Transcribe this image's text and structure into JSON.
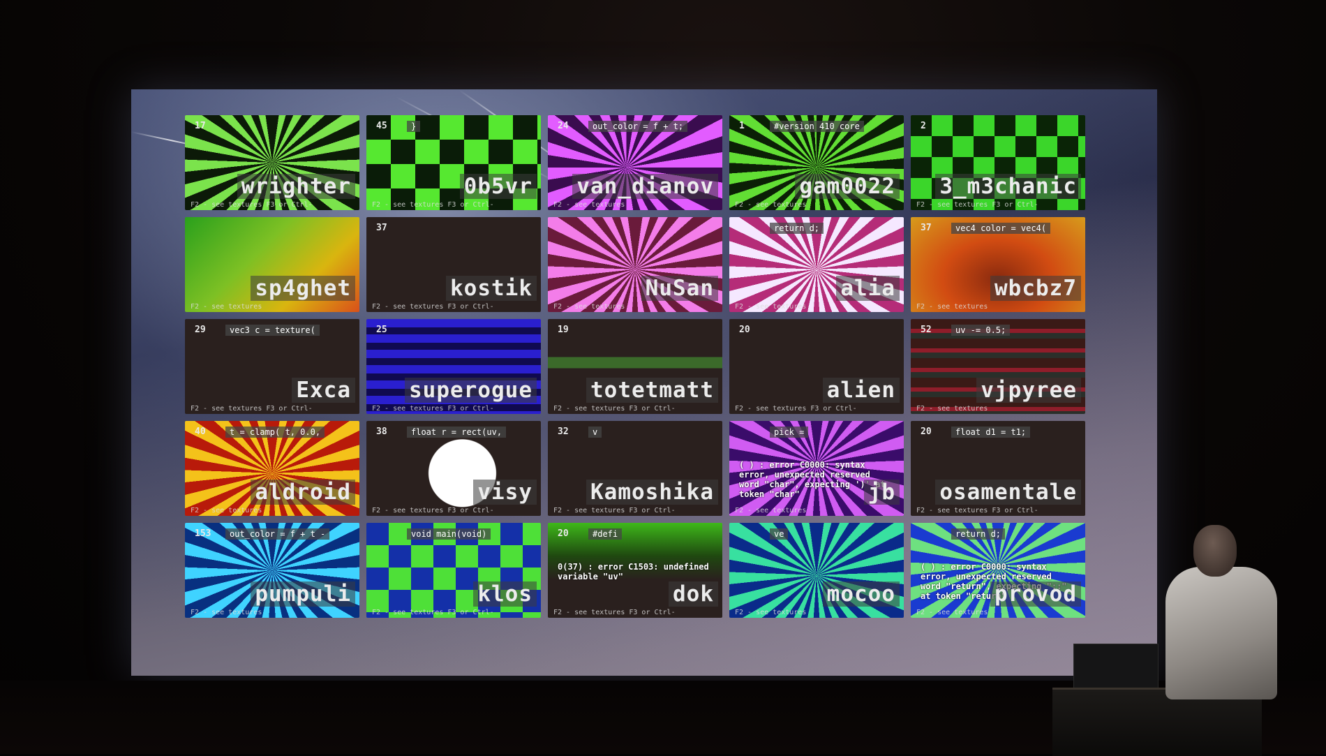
{
  "tiles": [
    {
      "num": "17",
      "code": "",
      "name": "wrighter",
      "footer": "F2 - see textures   F3 or Ctrl-",
      "bg": "tunnel-green"
    },
    {
      "num": "45",
      "code": "}",
      "name": "0b5vr",
      "footer": "F2 - see textures   F3 or Ctrl-",
      "bg": "check-green"
    },
    {
      "num": "24",
      "code": "out_color = f + t;",
      "name": "van_dianov",
      "footer": "F2 - see textures",
      "bg": "tunnel-purple"
    },
    {
      "num": "1",
      "code": "#version 410 core",
      "name": "gam0022",
      "footer": "F2 - see textures",
      "bg": "tunnel-green2"
    },
    {
      "num": "2",
      "code": "",
      "name": "3_m3chanic",
      "footer": "F2 - see textures   F3 or Ctrl-",
      "bg": "check-green2"
    },
    {
      "num": "",
      "code": "",
      "name": "sp4ghet",
      "footer": "F2 - see textures",
      "bg": "grad-lime"
    },
    {
      "num": "37",
      "code": "",
      "name": "kostik",
      "footer": "F2 - see textures   F3 or Ctrl-",
      "bg": "dark"
    },
    {
      "num": "",
      "code": "",
      "name": "NuSan",
      "footer": "F2 - see textures",
      "bg": "tunnel-pink"
    },
    {
      "num": "",
      "code": "return d;",
      "name": "alia",
      "footer": "F2 - see textures",
      "bg": "tunnel-white"
    },
    {
      "num": "37",
      "code": "vec4 color = vec4(",
      "name": "wbcbz7",
      "footer": "F2 - see textures",
      "bg": "grad-orange"
    },
    {
      "num": "29",
      "code": "vec3 c = texture(",
      "name": "Exca",
      "footer": "F2 - see textures   F3 or Ctrl-",
      "bg": "dark"
    },
    {
      "num": "25",
      "code": "",
      "name": "superogue",
      "footer": "F2 - see textures   F3 or Ctrl-",
      "bg": "stripes-blue"
    },
    {
      "num": "19",
      "code": "",
      "name": "totetmatt",
      "footer": "F2 - see textures   F3 or Ctrl-",
      "bg": "dark-logo"
    },
    {
      "num": "20",
      "code": "",
      "name": "alien",
      "footer": "F2 - see textures   F3 or Ctrl-",
      "bg": "dark"
    },
    {
      "num": "52",
      "code": "uv -= 0.5;",
      "name": "vjpyree",
      "footer": "F2 - see textures",
      "bg": "logo-wall"
    },
    {
      "num": "40",
      "code": "t = clamp( t, 0.0,",
      "name": "aldroid",
      "footer": "F2 - see textures",
      "bg": "tunnel-orange"
    },
    {
      "num": "38",
      "code": "float r = rect(uv,",
      "name": "visy",
      "footer": "F2 - see textures   F3 or Ctrl-",
      "bg": "dark-white"
    },
    {
      "num": "32",
      "code": "v",
      "name": "Kamoshika",
      "footer": "F2 - see textures   F3 or Ctrl-",
      "bg": "dark"
    },
    {
      "num": "",
      "code": "pick =",
      "name": "jb",
      "footer": "F2 - see textures",
      "bg": "tunnel-violet",
      "err": "( ) : error C0000: syntax error, unexpected reserved word \"char\", expecting ')' at token \"char\""
    },
    {
      "num": "20",
      "code": "float d1 = t1;",
      "name": "osamentale",
      "footer": "F2 - see textures   F3 or Ctrl-",
      "bg": "dark"
    },
    {
      "num": "153",
      "code": "out_color = f + t -",
      "name": "pumpuli",
      "footer": "F2 - see textures",
      "bg": "tunnel-cyan"
    },
    {
      "num": "",
      "code": "void main(void)",
      "name": "klos",
      "footer": "F2 - see textures   F3 or Ctrl-",
      "bg": "check-blue"
    },
    {
      "num": "20",
      "code": "#defi",
      "name": "dok",
      "footer": "F2 - see textures   F3 or Ctrl-",
      "bg": "grad-green-dark",
      "err": "0(37) : error C1503: undefined variable \"uv\""
    },
    {
      "num": "",
      "code": "ve",
      "name": "mocoo",
      "footer": "F2 - see textures",
      "bg": "tunnel-teal"
    },
    {
      "num": "",
      "code": "return d;",
      "name": "provod",
      "footer": "F2 - see textures",
      "bg": "tunnel-blue",
      "err": "( ) : error C0000: syntax error, unexpected reserved word \"return\", expecting \"::\" at token \"return\""
    }
  ]
}
